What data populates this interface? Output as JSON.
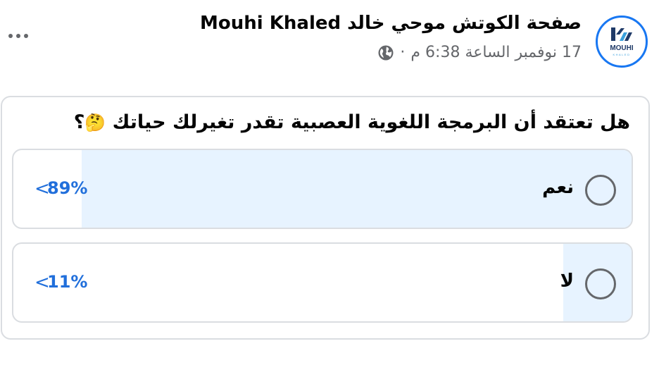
{
  "header": {
    "page_name": "صفحة الكوتش موحي خالد Mouhi Khaled",
    "timestamp": "17 نوفمبر الساعة 6:38 م",
    "separator": "·",
    "privacy_icon": "globe-icon",
    "more_icon": "more-horizontal-icon"
  },
  "avatar": {
    "logo_text": "MOUHI",
    "logo_subtext": "KHALED"
  },
  "poll": {
    "question": "هل تعتقد أن البرمجة اللغوية العصبية تقدر تغيرلك حياتك",
    "question_emoji": "🤔",
    "question_mark": "؟",
    "options": [
      {
        "label": "نعم",
        "percent": "89%",
        "fraction": 0.89,
        "chevron": "<"
      },
      {
        "label": "لا",
        "percent": "11%",
        "fraction": 0.11,
        "chevron": "<"
      }
    ]
  },
  "colors": {
    "accent": "#1877f2",
    "percent_text": "#216fdb",
    "fill": "#e7f3ff",
    "secondary_text": "#65676b",
    "border": "#dadde1"
  }
}
